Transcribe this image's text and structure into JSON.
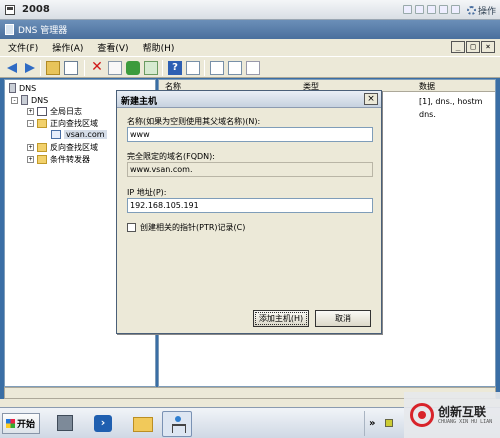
{
  "vm": {
    "title": "2008",
    "ops_label": "操作"
  },
  "app": {
    "title": "DNS 管理器",
    "window_buttons": [
      "_",
      "□",
      "×"
    ]
  },
  "menu": [
    "文件(F)",
    "操作(A)",
    "查看(V)",
    "帮助(H)"
  ],
  "toolbar_icons": [
    "back-arrow-icon",
    "forward-arrow-icon",
    "up-folder-icon",
    "show-hide-tree-icon",
    "delete-icon",
    "properties-icon",
    "refresh-icon",
    "export-list-icon",
    "help-icon",
    "columns-icon",
    "list-icon",
    "details-icon",
    "document-icon"
  ],
  "tree": {
    "root": "DNS",
    "server": "DNS",
    "items": [
      {
        "label": "全局日志",
        "expander": "+"
      },
      {
        "label": "正向查找区域",
        "expander": "-"
      },
      {
        "label": "vsan.com",
        "expander": ""
      },
      {
        "label": "反向查找区域",
        "expander": "+"
      },
      {
        "label": "条件转发器",
        "expander": "+"
      }
    ]
  },
  "list": {
    "columns": [
      "名称",
      "类型",
      "数据"
    ],
    "rows": [
      {
        "data": "[1], dns., hostm"
      },
      {
        "data": "dns."
      }
    ]
  },
  "dialog": {
    "title": "新建主机",
    "close_label": "×",
    "name_label": "名称(如果为空则使用其父域名称)(N):",
    "name_value": "www",
    "fqdn_label": "完全限定的域名(FQDN):",
    "fqdn_value": "www.vsan.com.",
    "ip_label": "IP 地址(P):",
    "ip_value": "192.168.105.191",
    "ptr_label": "创建相关的指针(PTR)记录(C)",
    "ptr_checked": false,
    "add_button": "添加主机(H)",
    "cancel_button": "取消"
  },
  "taskbar": {
    "start_label": "开始",
    "tray_chevron": "»"
  },
  "brand": {
    "name": "创新互联",
    "sub": "CHUANG XIN HU LIAN"
  }
}
